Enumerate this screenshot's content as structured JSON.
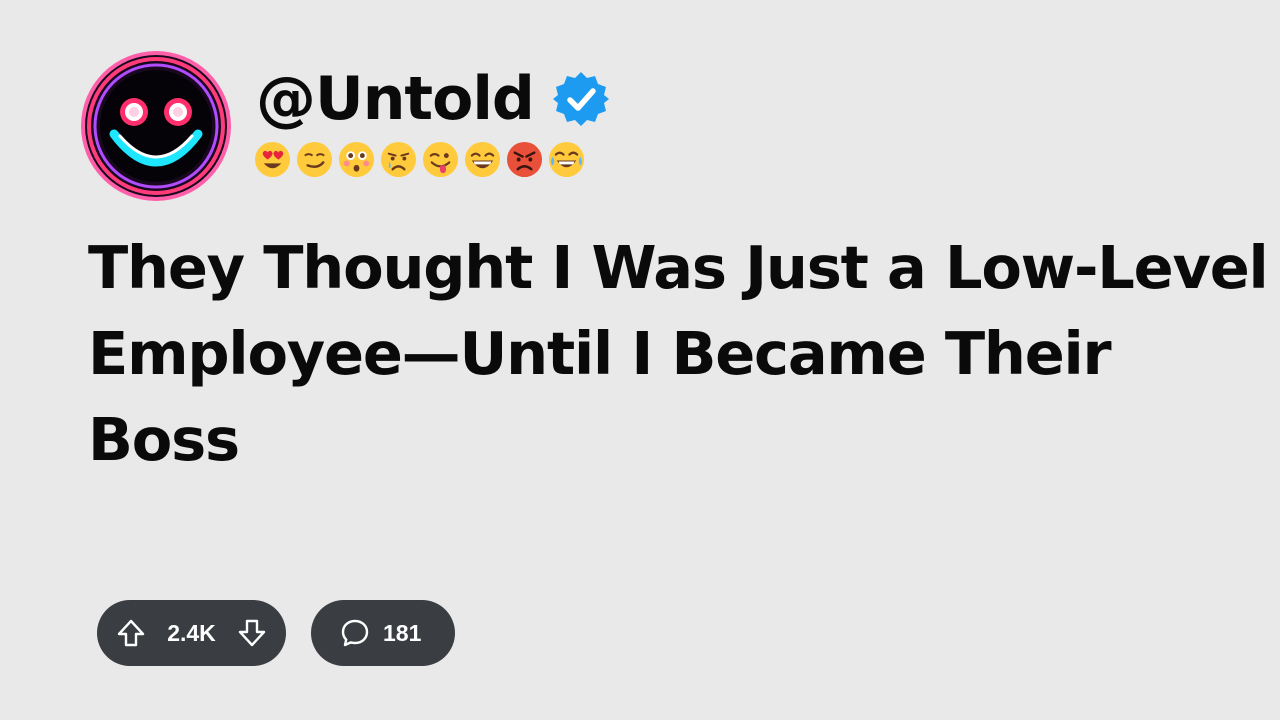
{
  "post": {
    "username": "@Untold",
    "verified": true,
    "avatar_icon": "neon-smiley-icon",
    "emojis": [
      "heart-eyes-emoji",
      "smirk-emoji",
      "flushed-emoji",
      "crying-emoji",
      "tongue-wink-emoji",
      "grin-emoji",
      "angry-emoji",
      "tears-of-joy-emoji"
    ],
    "title": "They Thought I Was Just a Low-Level Employee—Until I Became Their Boss"
  },
  "actions": {
    "vote_count": "2.4K",
    "comment_count": "181"
  },
  "colors": {
    "background": "#e9e9ea",
    "verified_badge": "#1d9bf0",
    "pill_background": "#3a3d42",
    "text": "#0a0a0a"
  }
}
